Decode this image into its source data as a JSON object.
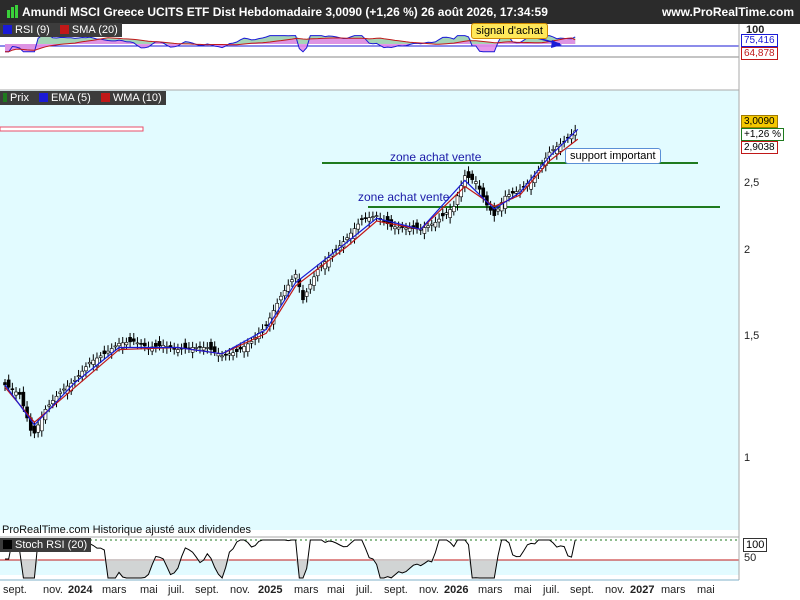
{
  "header": {
    "title": "Amundi MSCI Greece UCITS ETF Dist Hebdomadaire 3,0090 (+1,26 %) 26 août 2026, 17:34:59",
    "brand": "www.ProRealTime.com"
  },
  "colors": {
    "background": "#e2fbff",
    "candle_up": "#ffffff",
    "candle_down": "#000000",
    "ema": "#1a1ad6",
    "wma": "#c01818",
    "rsi_area_above": "#9acfae",
    "rsi_area_below": "#e38ce8",
    "support_line": "#1e7a1e",
    "resistance_box": "#e84d6a"
  },
  "rsi_panel": {
    "legend": [
      {
        "label": "RSI (9)",
        "color": "#1a1ad6"
      },
      {
        "label": "SMA (20)",
        "color": "#c01818"
      }
    ],
    "scale_top": "100",
    "rsi_value": "75,416",
    "sma_value": "64,878",
    "annotation": "signal d'achat"
  },
  "price_panel": {
    "legend": [
      {
        "label": "Prix",
        "color": "#1e7a1e"
      },
      {
        "label": "EMA (5)",
        "color": "#1a1ad6"
      },
      {
        "label": "WMA (10)",
        "color": "#c01818"
      }
    ],
    "last_price": "3,0090",
    "change_pct": "+1,26 %",
    "wma_value": "2,9038",
    "y_ticks": [
      "2,5",
      "2",
      "1,5",
      "1"
    ],
    "annotations": {
      "zone_upper": "zone achat vente",
      "zone_lower": "zone achat vente",
      "support": "support important"
    },
    "footer": "ProRealTime.com Historique ajusté aux dividendes"
  },
  "stoch_panel": {
    "legend": [
      {
        "label": "Stoch RSI (20)",
        "color": "#000000"
      }
    ],
    "value": "100",
    "level": "50"
  },
  "x_axis": {
    "labels": [
      {
        "text": "sept.",
        "year": false
      },
      {
        "text": "nov.",
        "year": false
      },
      {
        "text": "2024",
        "year": true
      },
      {
        "text": "mars",
        "year": false
      },
      {
        "text": "mai",
        "year": false
      },
      {
        "text": "juil.",
        "year": false
      },
      {
        "text": "sept.",
        "year": false
      },
      {
        "text": "nov.",
        "year": false
      },
      {
        "text": "2025",
        "year": true
      },
      {
        "text": "mars",
        "year": false
      },
      {
        "text": "mai",
        "year": false
      },
      {
        "text": "juil.",
        "year": false
      },
      {
        "text": "sept.",
        "year": false
      },
      {
        "text": "nov.",
        "year": false
      },
      {
        "text": "2026",
        "year": true
      },
      {
        "text": "mars",
        "year": false
      },
      {
        "text": "mai",
        "year": false
      },
      {
        "text": "juil.",
        "year": false
      },
      {
        "text": "sept.",
        "year": false
      },
      {
        "text": "nov.",
        "year": false
      },
      {
        "text": "2027",
        "year": true
      },
      {
        "text": "mars",
        "year": false
      },
      {
        "text": "mai",
        "year": false
      }
    ]
  },
  "chart_data": {
    "type": "line",
    "title": "Amundi MSCI Greece UCITS ETF Dist Hebdomadaire",
    "price_scale": "log",
    "ylim": [
      0.9,
      3.2
    ],
    "x_range": [
      "2023-09-01",
      "2027-05-31"
    ],
    "last_close": 3.009,
    "change_pct": 1.26,
    "ema5_last": 3.0,
    "wma10_last": 2.9038,
    "series": [
      {
        "name": "Prix",
        "points": [
          [
            "2023-09-01",
            1.28
          ],
          [
            "2023-09-29",
            1.24
          ],
          [
            "2023-10-20",
            1.1
          ],
          [
            "2023-10-27",
            1.09
          ],
          [
            "2023-11-17",
            1.18
          ],
          [
            "2023-12-15",
            1.25
          ],
          [
            "2024-01-12",
            1.3
          ],
          [
            "2024-02-09",
            1.38
          ],
          [
            "2024-03-08",
            1.42
          ],
          [
            "2024-04-05",
            1.47
          ],
          [
            "2024-05-03",
            1.48
          ],
          [
            "2024-05-31",
            1.45
          ],
          [
            "2024-06-28",
            1.46
          ],
          [
            "2024-07-26",
            1.44
          ],
          [
            "2024-08-23",
            1.45
          ],
          [
            "2024-09-20",
            1.45
          ],
          [
            "2024-10-18",
            1.41
          ],
          [
            "2024-11-15",
            1.43
          ],
          [
            "2024-12-13",
            1.48
          ],
          [
            "2025-01-10",
            1.56
          ],
          [
            "2025-02-07",
            1.72
          ],
          [
            "2025-03-07",
            1.85
          ],
          [
            "2025-03-21",
            1.7
          ],
          [
            "2025-04-18",
            1.88
          ],
          [
            "2025-05-16",
            1.98
          ],
          [
            "2025-06-13",
            2.09
          ],
          [
            "2025-07-11",
            2.22
          ],
          [
            "2025-08-08",
            2.25
          ],
          [
            "2025-09-05",
            2.17
          ],
          [
            "2025-10-03",
            2.16
          ],
          [
            "2025-10-31",
            2.15
          ],
          [
            "2025-11-28",
            2.2
          ],
          [
            "2026-01-02",
            2.32
          ],
          [
            "2026-01-23",
            2.57
          ],
          [
            "2026-02-13",
            2.52
          ],
          [
            "2026-03-06",
            2.33
          ],
          [
            "2026-03-20",
            2.25
          ],
          [
            "2026-04-10",
            2.4
          ],
          [
            "2026-05-08",
            2.45
          ],
          [
            "2026-06-05",
            2.56
          ],
          [
            "2026-07-03",
            2.78
          ],
          [
            "2026-07-31",
            2.88
          ],
          [
            "2026-08-26",
            3.009
          ]
        ]
      },
      {
        "name": "EMA (5)",
        "points": [
          [
            "2023-09-01",
            1.28
          ],
          [
            "2023-10-27",
            1.12
          ],
          [
            "2024-01-12",
            1.29
          ],
          [
            "2024-04-05",
            1.45
          ],
          [
            "2024-07-26",
            1.45
          ],
          [
            "2024-10-18",
            1.42
          ],
          [
            "2025-01-10",
            1.54
          ],
          [
            "2025-03-07",
            1.8
          ],
          [
            "2025-06-13",
            2.06
          ],
          [
            "2025-08-08",
            2.23
          ],
          [
            "2025-10-31",
            2.15
          ],
          [
            "2026-01-23",
            2.53
          ],
          [
            "2026-03-20",
            2.3
          ],
          [
            "2026-05-08",
            2.43
          ],
          [
            "2026-07-03",
            2.74
          ],
          [
            "2026-08-26",
            3.0
          ]
        ]
      },
      {
        "name": "WMA (10)",
        "points": [
          [
            "2023-09-01",
            1.27
          ],
          [
            "2023-10-27",
            1.13
          ],
          [
            "2024-01-12",
            1.27
          ],
          [
            "2024-04-05",
            1.44
          ],
          [
            "2024-07-26",
            1.45
          ],
          [
            "2024-10-18",
            1.42
          ],
          [
            "2025-01-10",
            1.52
          ],
          [
            "2025-03-07",
            1.78
          ],
          [
            "2025-06-13",
            2.03
          ],
          [
            "2025-08-08",
            2.21
          ],
          [
            "2025-10-31",
            2.15
          ],
          [
            "2026-01-23",
            2.48
          ],
          [
            "2026-03-20",
            2.32
          ],
          [
            "2026-05-08",
            2.41
          ],
          [
            "2026-07-03",
            2.7
          ],
          [
            "2026-08-26",
            2.9038
          ]
        ]
      }
    ],
    "levels": [
      {
        "label": "zone achat vente",
        "price": 2.65,
        "from": "2025-07-20",
        "to": "2027-04-10"
      },
      {
        "label": "zone achat vente",
        "price": 2.32,
        "from": "2025-09-10",
        "to": "2027-05-20"
      },
      {
        "label": "",
        "price": 2.93,
        "from": "2023-09-01",
        "to": "2024-05-31"
      }
    ],
    "indicators": {
      "rsi_9": {
        "last": 75.416,
        "range": [
          0,
          100
        ]
      },
      "rsi_sma_20": {
        "last": 64.878
      },
      "stoch_rsi_20": {
        "last": 100,
        "levels": [
          50,
          100
        ]
      }
    }
  }
}
